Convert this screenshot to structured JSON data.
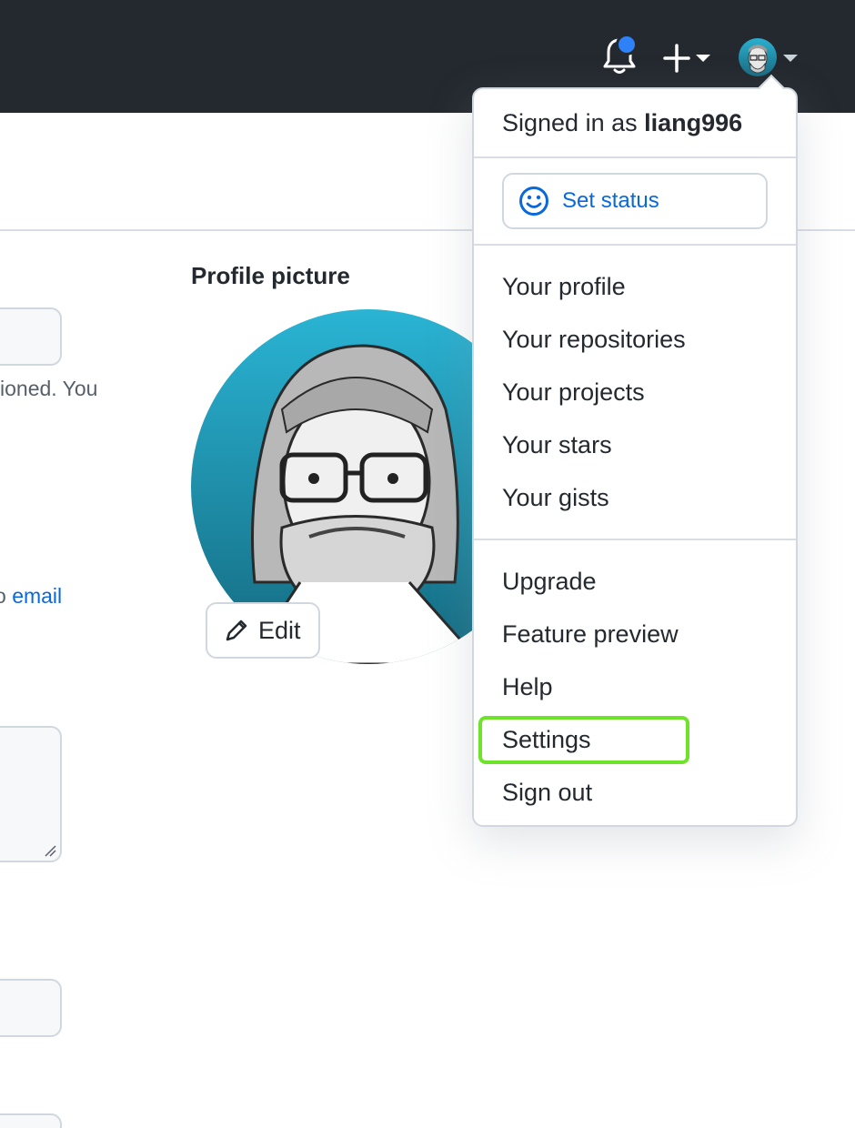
{
  "header": {
    "icons": [
      "bell-icon",
      "plus-icon",
      "caret-down-icon",
      "avatar"
    ]
  },
  "background": {
    "partial_text_1": "ioned. You",
    "partial_text_2": "o ",
    "partial_link": "email",
    "profile_picture_title": "Profile picture",
    "edit_label": "Edit"
  },
  "dropdown": {
    "signed_in_prefix": "Signed in as ",
    "username": "liang996",
    "set_status_label": "Set status",
    "items": [
      {
        "label": "Your profile"
      },
      {
        "label": "Your repositories"
      },
      {
        "label": "Your projects"
      },
      {
        "label": "Your stars"
      },
      {
        "label": "Your gists"
      },
      {
        "label": "Upgrade"
      },
      {
        "label": "Feature preview"
      },
      {
        "label": "Help"
      },
      {
        "label": "Settings"
      },
      {
        "label": "Sign out"
      }
    ],
    "highlighted_item": "Settings"
  },
  "colors": {
    "header_bg": "#24292f",
    "link_blue": "#0969da",
    "notification_dot": "#2f81f7",
    "highlight_green": "#6fe32a"
  }
}
